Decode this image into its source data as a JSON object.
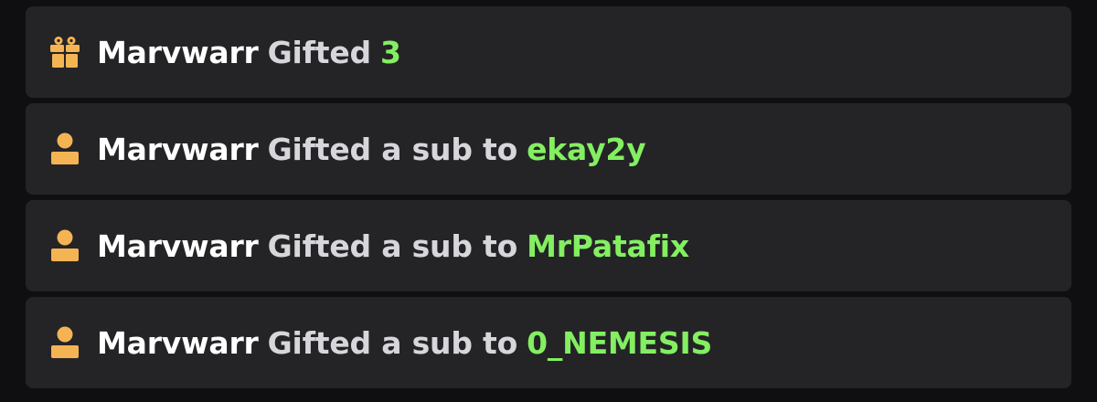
{
  "colors": {
    "background": "#0f0f11",
    "row_background": "#242427",
    "username": "#ffffff",
    "action_text": "#d7d7db",
    "highlight": "#83ef61",
    "icon": "#f5b453"
  },
  "events": [
    {
      "icon": "gift-icon",
      "user": "Marvwarr",
      "action": "Gifted",
      "target": "3"
    },
    {
      "icon": "user-icon",
      "user": "Marvwarr",
      "action": "Gifted a sub to",
      "target": "ekay2y"
    },
    {
      "icon": "user-icon",
      "user": "Marvwarr",
      "action": "Gifted a sub to",
      "target": "MrPatafix"
    },
    {
      "icon": "user-icon",
      "user": "Marvwarr",
      "action": "Gifted a sub to",
      "target": "0_NEMESIS"
    }
  ]
}
